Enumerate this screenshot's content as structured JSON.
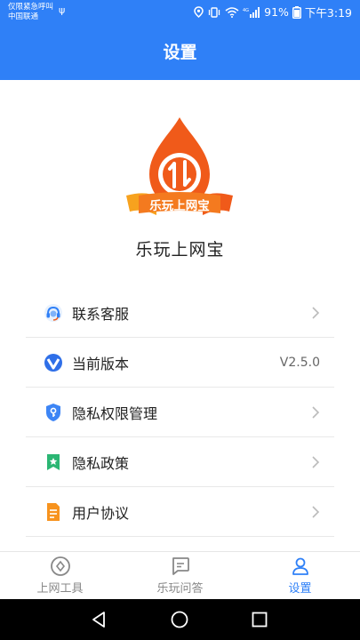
{
  "status_bar": {
    "carrier_line1": "仅限紧急呼叫",
    "carrier_line2": "中国联通",
    "usb_symbol": "ψ",
    "battery": "91%",
    "time": "下午3:19"
  },
  "header": {
    "title": "设置"
  },
  "app": {
    "name": "乐玩上网宝",
    "logo_text": "乐玩上网宝"
  },
  "menu": [
    {
      "label": "联系客服",
      "icon": "headset-icon",
      "value": ""
    },
    {
      "label": "当前版本",
      "icon": "version-v-icon",
      "value": "V2.5.0"
    },
    {
      "label": "隐私权限管理",
      "icon": "shield-key-icon",
      "value": ""
    },
    {
      "label": "隐私政策",
      "icon": "bookmark-star-icon",
      "value": ""
    },
    {
      "label": "用户协议",
      "icon": "document-icon",
      "value": ""
    }
  ],
  "tabs": [
    {
      "label": "上网工具",
      "icon": "compass-icon",
      "active": false
    },
    {
      "label": "乐玩问答",
      "icon": "chat-icon",
      "active": false
    },
    {
      "label": "设置",
      "icon": "user-icon",
      "active": true
    }
  ],
  "colors": {
    "primary": "#2f80f7",
    "logo_orange": "#f05a1a",
    "text": "#222222"
  }
}
